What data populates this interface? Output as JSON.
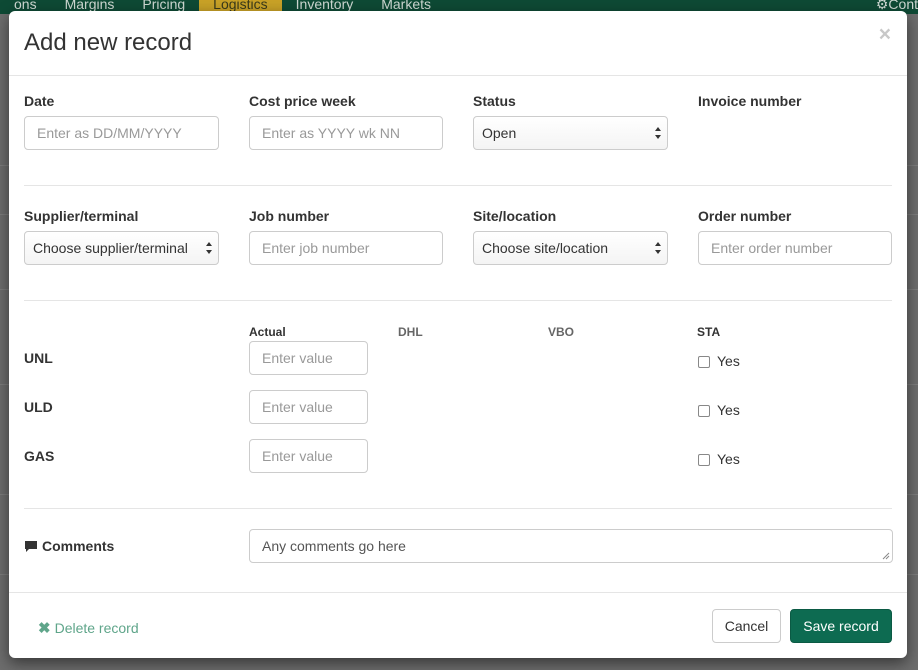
{
  "background_nav": {
    "items": [
      "ons",
      "Margins",
      "Pricing",
      "Logistics",
      "Inventory",
      "Markets"
    ],
    "active_index": 3,
    "right_label": "⚙Cont"
  },
  "modal": {
    "title": "Add new record",
    "close_symbol": "×",
    "row1": {
      "date": {
        "label": "Date",
        "placeholder": "Enter as DD/MM/YYYY"
      },
      "cost_price_week": {
        "label": "Cost price week",
        "placeholder": "Enter as YYYY wk NN"
      },
      "status": {
        "label": "Status",
        "value": "Open"
      },
      "invoice_number": {
        "label": "Invoice number"
      }
    },
    "row2": {
      "supplier": {
        "label": "Supplier/terminal",
        "value": "Choose supplier/terminal"
      },
      "job_number": {
        "label": "Job number",
        "placeholder": "Enter job number"
      },
      "site": {
        "label": "Site/location",
        "value": "Choose site/location"
      },
      "order_number": {
        "label": "Order number",
        "placeholder": "Enter order number"
      }
    },
    "grid": {
      "columns": [
        "Actual",
        "DHL",
        "VBO",
        "STA"
      ],
      "rows": [
        {
          "label": "UNL",
          "placeholder": "Enter value",
          "sta_label": "Yes",
          "sta_checked": false
        },
        {
          "label": "ULD",
          "placeholder": "Enter value",
          "sta_label": "Yes",
          "sta_checked": false
        },
        {
          "label": "GAS",
          "placeholder": "Enter value",
          "sta_label": "Yes",
          "sta_checked": false
        }
      ]
    },
    "comments": {
      "label": "Comments",
      "icon": "comment-icon",
      "value": "Any comments go here"
    },
    "footer": {
      "delete_label": "Delete record",
      "delete_icon": "✖",
      "cancel_label": "Cancel",
      "save_label": "Save record"
    }
  },
  "colors": {
    "brand_green": "#0d6b51",
    "delete_green": "#5fa58a",
    "nav_active": "#c9a227"
  }
}
